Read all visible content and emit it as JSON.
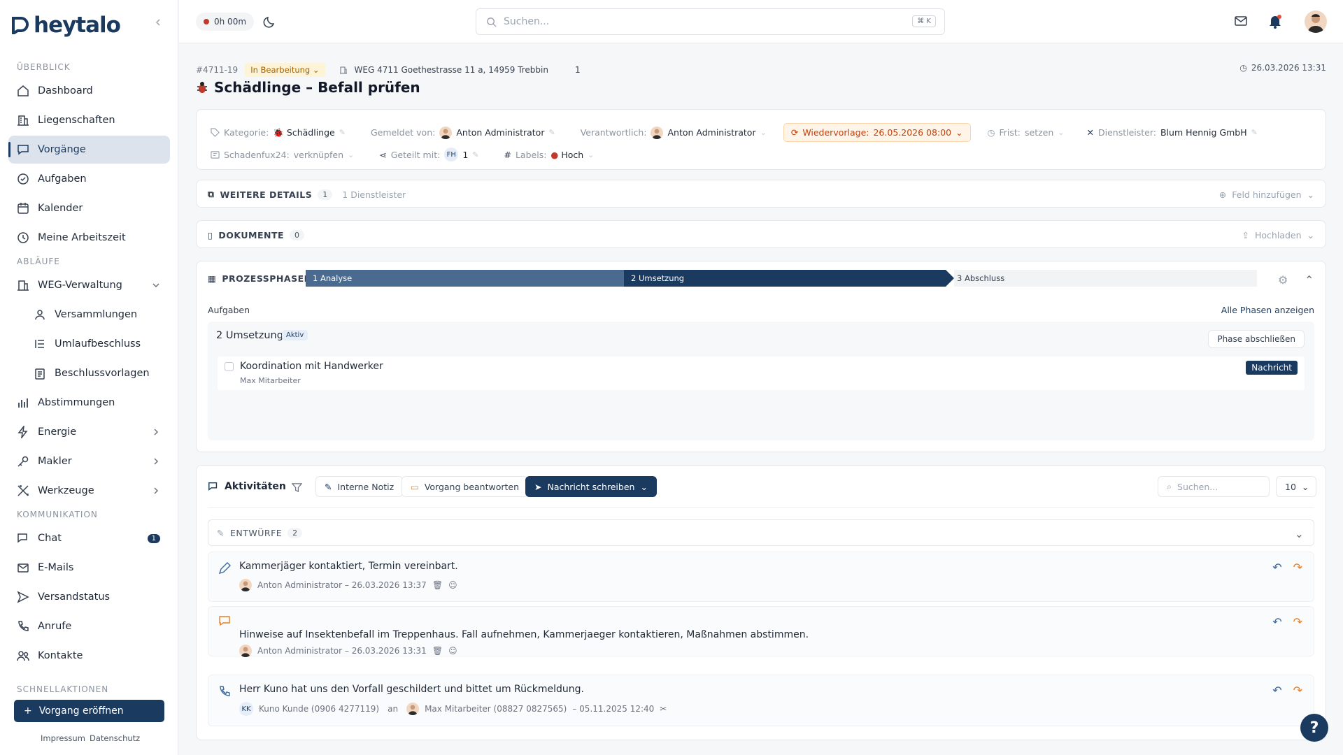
{
  "brand": {
    "name": "heytalo"
  },
  "sidebar": {
    "sections": {
      "overview": "ÜBERBLICK",
      "workflows": "ABLÄUFE",
      "communication": "KOMMUNIKATION",
      "quick": "SCHNELLAKTIONEN"
    },
    "items": {
      "dashboard": "Dashboard",
      "properties": "Liegenschaften",
      "cases": "Vorgänge",
      "tasks": "Aufgaben",
      "calendar": "Kalender",
      "worktime": "Meine Arbeitszeit",
      "weg": "WEG-Verwaltung",
      "assemblies": "Versammlungen",
      "circular": "Umlaufbeschluss",
      "templates": "Beschlussvorlagen",
      "votes": "Abstimmungen",
      "energy": "Energie",
      "broker": "Makler",
      "tools": "Werkzeuge",
      "chat": "Chat",
      "chat_badge": "1",
      "emails": "E-Mails",
      "shipping": "Versandstatus",
      "calls": "Anrufe",
      "contacts": "Kontakte"
    },
    "cta": "Vorgang eröffnen",
    "footer": {
      "imprint": "Impressum",
      "privacy": "Datenschutz"
    }
  },
  "topbar": {
    "timer": "0h 00m",
    "search_placeholder": "Suchen...",
    "shortcut": "⌘ K"
  },
  "case": {
    "id": "#4711-19",
    "status": "In Bearbeitung",
    "property": "WEG 4711 Goethestrasse 11 a, 14959 Trebbin",
    "count": "1",
    "date": "26.03.2026 13:31",
    "title": "Schädlinge – Befall prüfen",
    "fields": {
      "category_label": "Kategorie:",
      "category": "Schädlinge",
      "reporter_label": "Gemeldet von:",
      "reporter": "Anton Administrator",
      "responsible_label": "Verantwortlich:",
      "responsible": "Anton Administrator",
      "followup_label": "Wiedervorlage:",
      "followup": "26.05.2026 08:00",
      "deadline_label": "Frist:",
      "deadline": "setzen",
      "provider_label": "Dienstleister:",
      "provider": "Blum Hennig GmbH",
      "schadenfux_label": "Schadenfux24:",
      "schadenfux": "verknüpfen",
      "shared_label": "Geteilt mit:",
      "shared_initials": "FH",
      "shared_count": "1",
      "labels_label": "Labels:",
      "label": "Hoch"
    }
  },
  "details": {
    "title": "WEITERE DETAILS",
    "count": "1",
    "subtitle": "1 Dienstleister",
    "action": "Feld hinzufügen"
  },
  "documents": {
    "title": "DOKUMENTE",
    "count": "0",
    "action": "Hochladen"
  },
  "process": {
    "title": "PROZESSPHASEN",
    "phases": [
      "1 Analyse",
      "2 Umsetzung",
      "3 Abschluss"
    ],
    "tasks_label": "Aufgaben",
    "all_phases": "Alle Phasen anzeigen",
    "current": "2 Umsetzung",
    "current_badge": "Aktiv",
    "close_phase": "Phase abschließen",
    "task": {
      "title": "Koordination mit Handwerker",
      "assignee": "Max Mitarbeiter",
      "action": "Nachricht"
    }
  },
  "activities": {
    "title": "Aktivitäten",
    "internal_note": "Interne Notiz",
    "reply": "Vorgang beantworten",
    "write": "Nachricht schreiben",
    "search_placeholder": "Suchen...",
    "page_size": "10",
    "drafts": {
      "title": "ENTWÜRFE",
      "count": "2"
    },
    "items": [
      {
        "text": "Kammerjäger kontaktiert, Termin vereinbart.",
        "meta": "Anton Administrator – 26.03.2026 13:37"
      },
      {
        "text": "Hinweise auf Insektenbefall im Treppenhaus. Fall aufnehmen, Kammerjaeger kontaktieren, Maßnahmen abstimmen.",
        "meta": "Anton Administrator – 26.03.2026 13:31"
      },
      {
        "text": "Herr Kuno hat uns den Vorfall geschildert und bittet um Rückmeldung.",
        "from_initials": "KK",
        "from": "Kuno Kunde (0906 4277119)",
        "to_label": "an",
        "to": "Max Mitarbeiter (08827 0827565)",
        "time": "– 05.11.2025 12:40"
      }
    ]
  },
  "help": "?",
  "colors": {
    "primary": "#1a3a5f",
    "phase1": "#4a6b8f",
    "warning": "#c2410c",
    "status": "#a16207"
  }
}
